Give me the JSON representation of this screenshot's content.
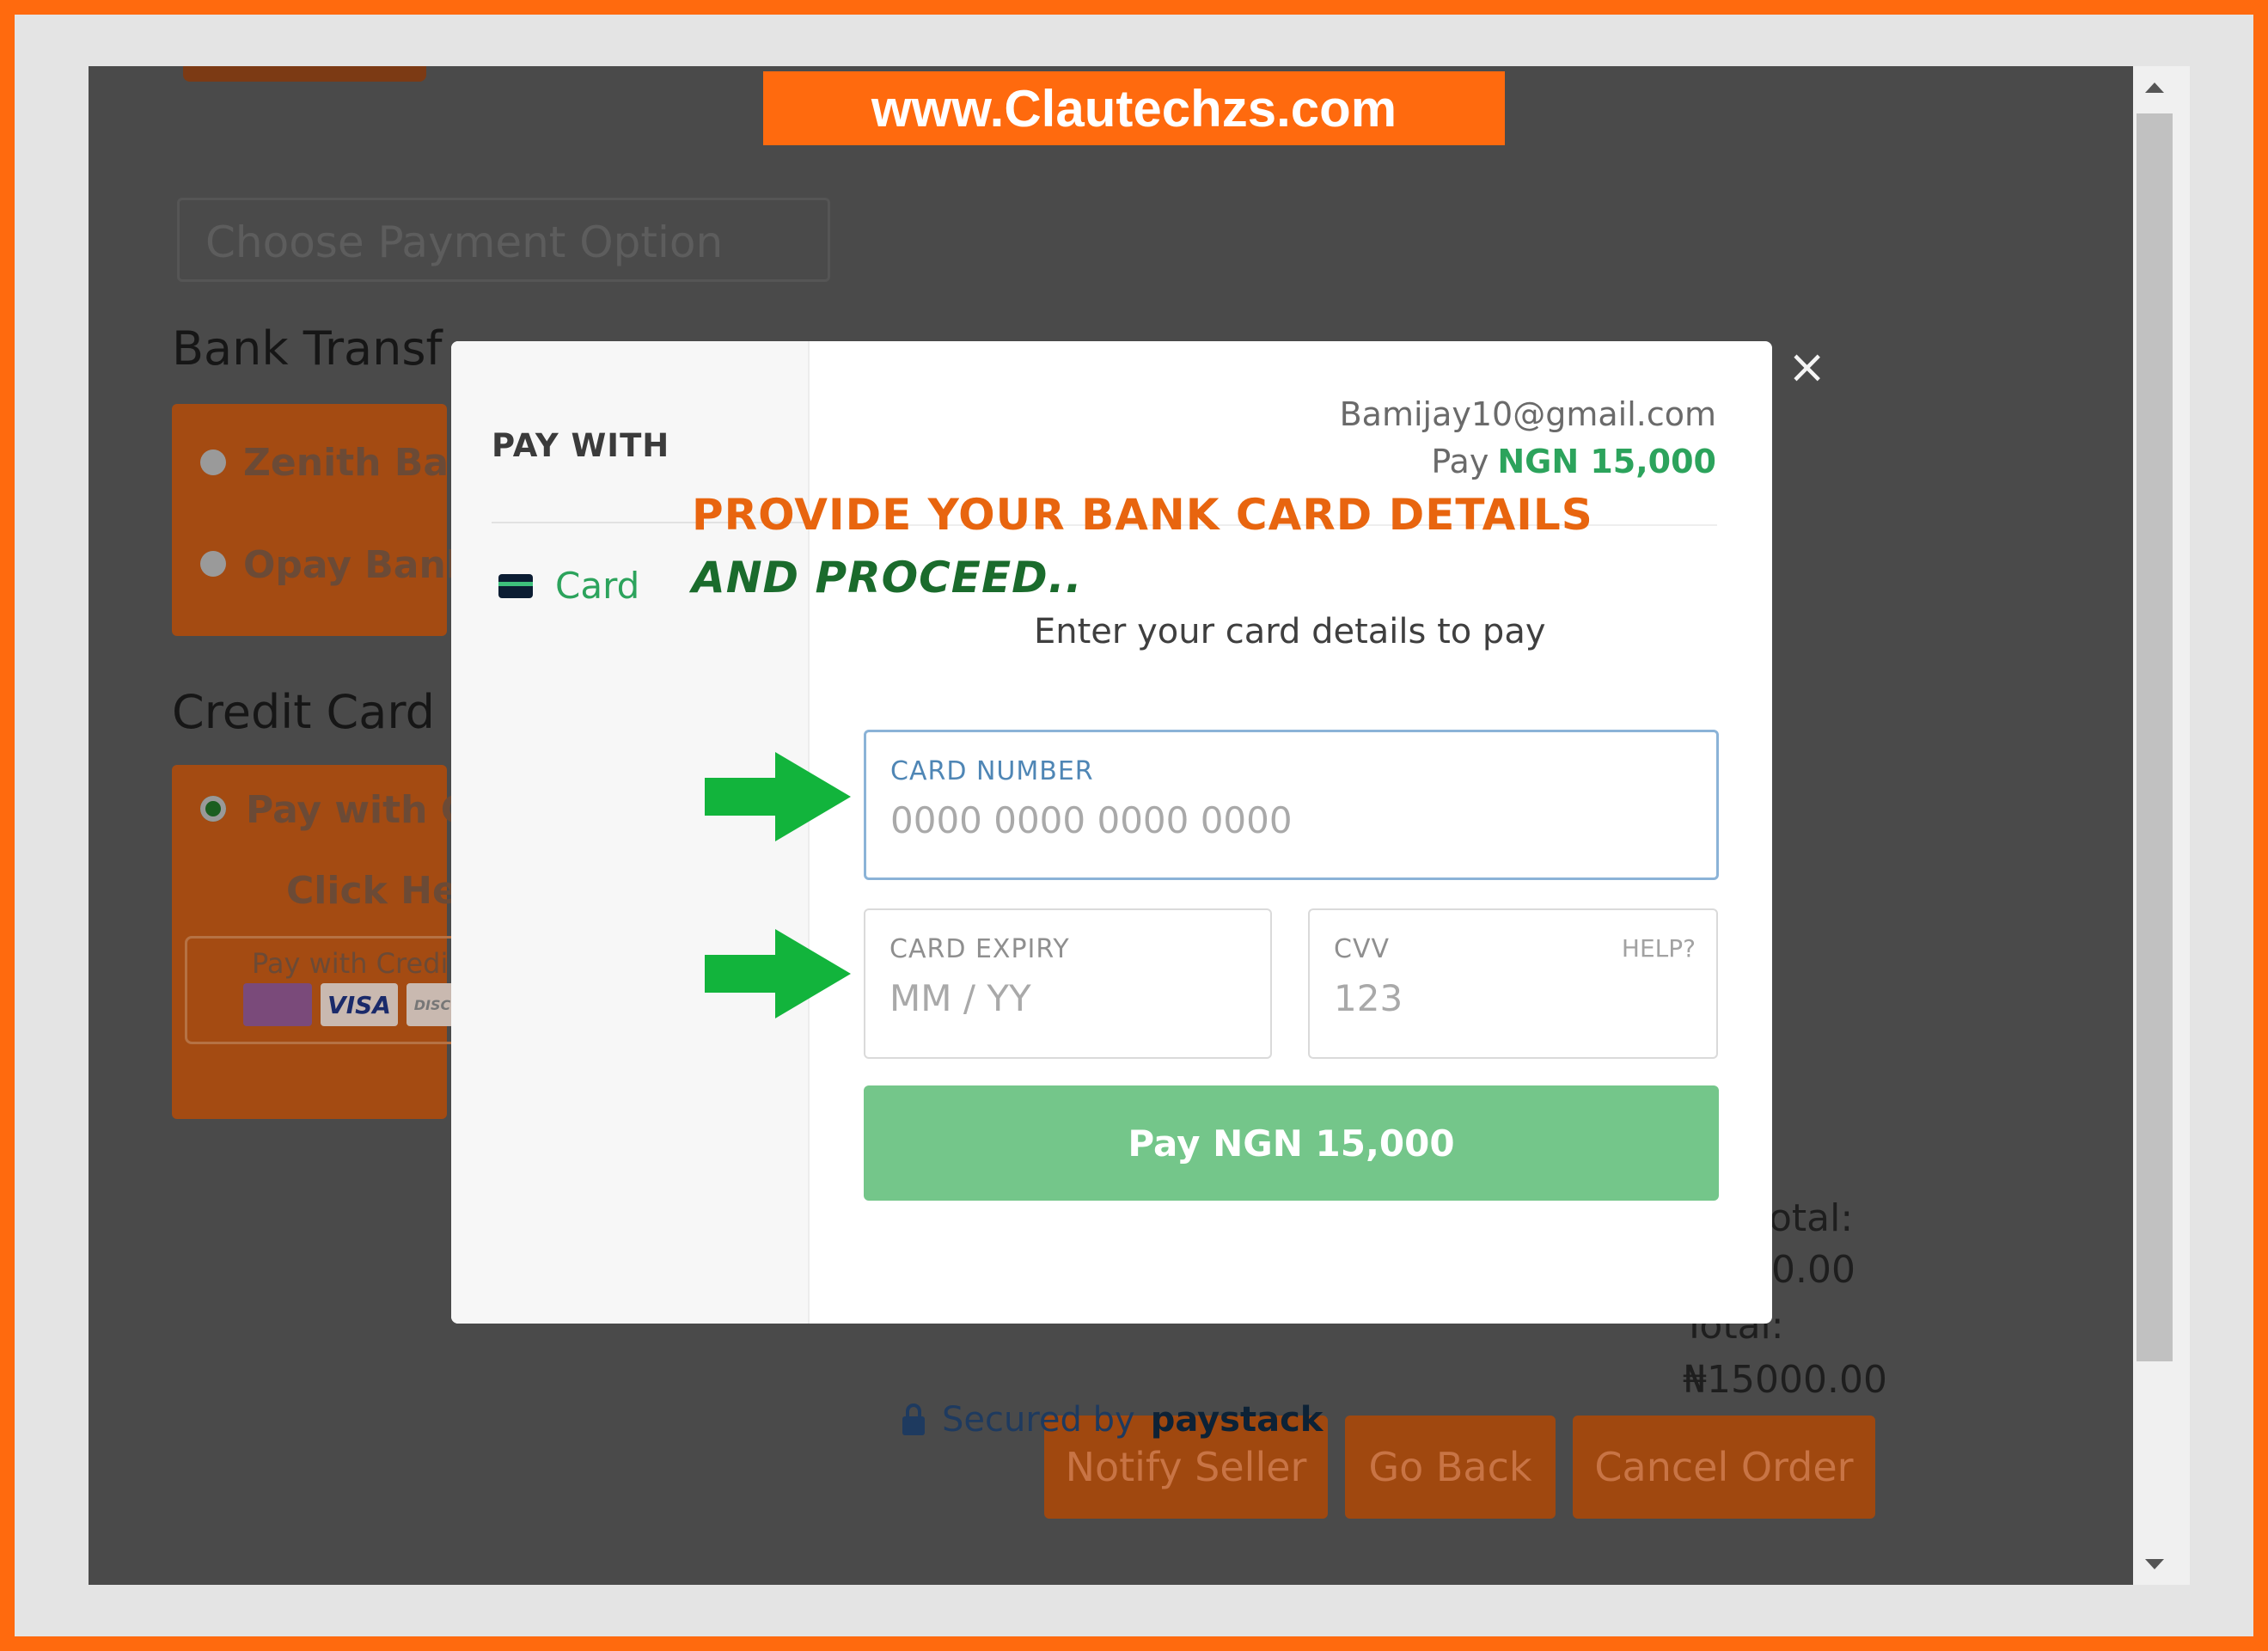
{
  "watermark": "www.Clautechzs.com",
  "background_page": {
    "choose_payment_placeholder": "Choose Payment Option",
    "bank_transfer_heading": "Bank Transf",
    "bank_options": [
      "Zenith Ban",
      "Opay Bank"
    ],
    "credit_card_heading": "Credit Card",
    "credit_option": "Pay with C",
    "click_here": "Click He",
    "card_box_text": "Pay with Credi",
    "card_logos": [
      "VISA",
      "DISC"
    ],
    "subtotal_label": "otal:",
    "subtotal_value": "00.00",
    "total_label": "Total:",
    "total_value": "₦15000.00",
    "buttons": [
      "Notify Seller",
      "Go Back",
      "Cancel Order"
    ],
    "secured_text": "Secured by",
    "secured_brand": "paystack"
  },
  "modal": {
    "pay_with_label": "PAY WITH",
    "method_card_label": "Card",
    "close_symbol": "×",
    "email": "Bamijay10@gmail.com",
    "pay_prefix": "Pay",
    "pay_amount": "NGN 15,000",
    "instruction": "Enter your card details to pay",
    "card_number": {
      "label": "CARD NUMBER",
      "placeholder": "0000 0000 0000 0000"
    },
    "card_expiry": {
      "label": "CARD EXPIRY",
      "placeholder": "MM / YY"
    },
    "cvv": {
      "label": "CVV",
      "help": "HELP?",
      "placeholder": "123"
    },
    "pay_button": "Pay NGN 15,000"
  },
  "annotation": {
    "line1": "PROVIDE YOUR BANK CARD DETAILS",
    "line2": "AND PROCEED.."
  },
  "colors": {
    "brand_orange": "#ff6a0e",
    "paystack_green": "#2ca35c",
    "arrow_green": "#12b43c"
  }
}
